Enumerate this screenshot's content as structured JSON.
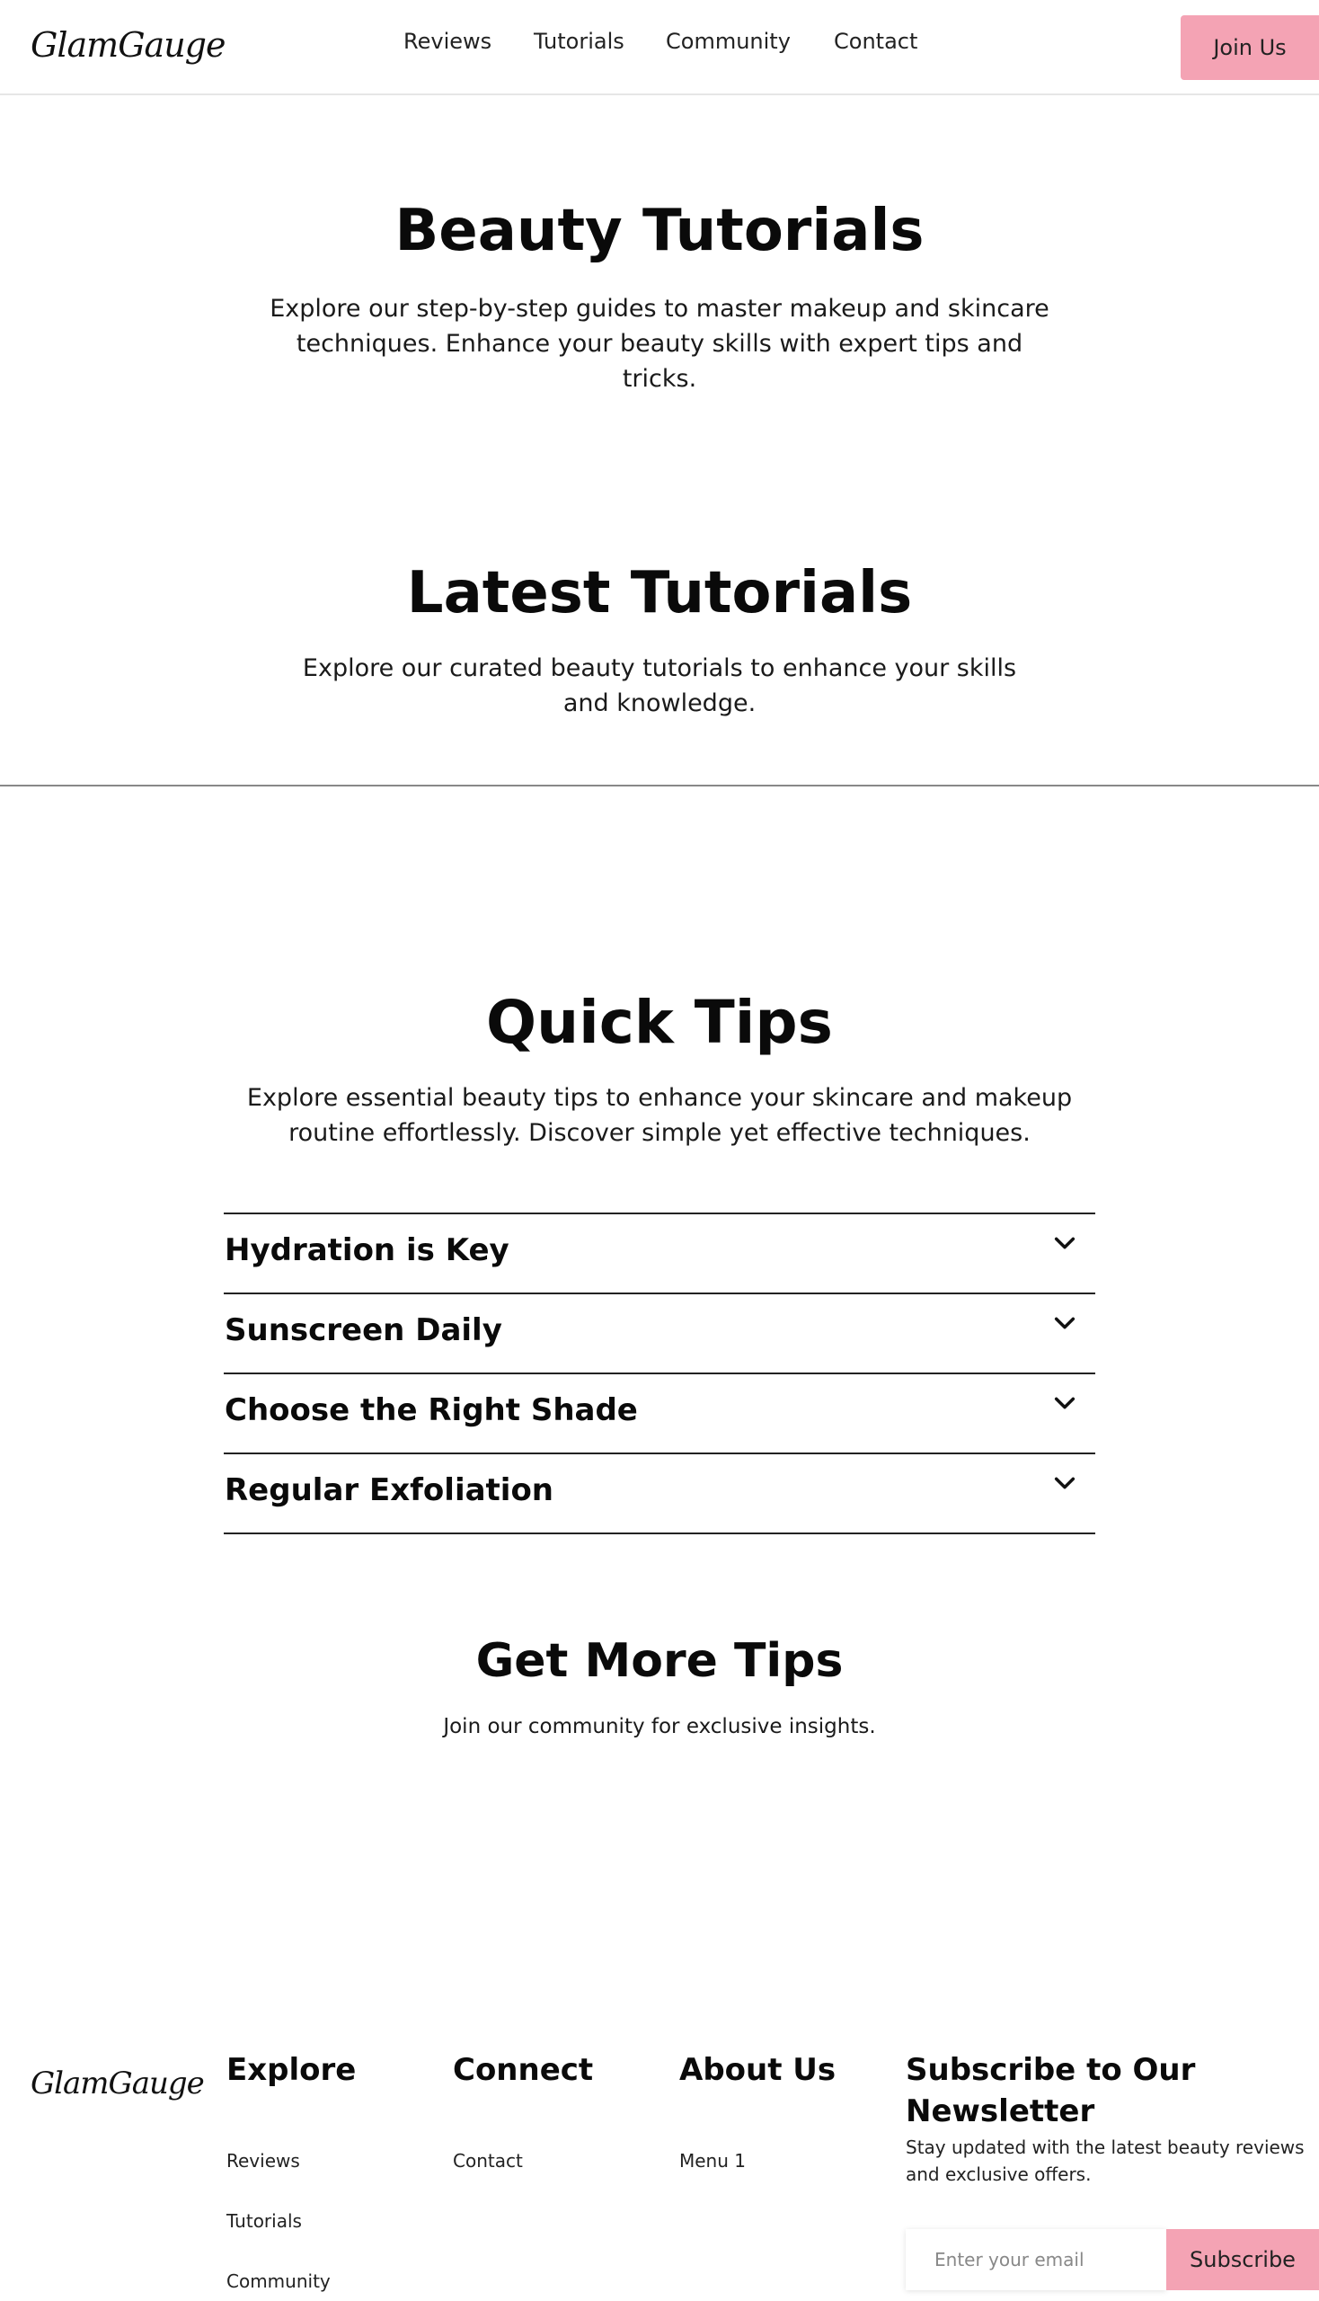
{
  "brand": {
    "logo_text": "GlamGauge"
  },
  "header": {
    "nav": [
      {
        "label": "Reviews"
      },
      {
        "label": "Tutorials"
      },
      {
        "label": "Community"
      },
      {
        "label": "Contact"
      }
    ],
    "cta_label": "Join Us"
  },
  "hero": {
    "title": "Beauty Tutorials",
    "description": "Explore our step-by-step guides to master makeup and skincare techniques. Enhance your beauty skills with expert tips and tricks."
  },
  "latest": {
    "title": "Latest Tutorials",
    "description": "Explore our curated beauty tutorials to enhance your skills and knowledge."
  },
  "quick_tips": {
    "title": "Quick Tips",
    "description": "Explore essential beauty tips to enhance your skincare and makeup routine effortlessly. Discover simple yet effective techniques.",
    "items": [
      {
        "title": "Hydration is Key"
      },
      {
        "title": "Sunscreen Daily"
      },
      {
        "title": "Choose the Right Shade"
      },
      {
        "title": "Regular Exfoliation"
      }
    ]
  },
  "more_tips": {
    "title": "Get More Tips",
    "description": "Join our community for exclusive insights."
  },
  "footer": {
    "explore": {
      "heading": "Explore",
      "links": [
        "Reviews",
        "Tutorials",
        "Community"
      ]
    },
    "connect": {
      "heading": "Connect",
      "links": [
        "Contact"
      ]
    },
    "about": {
      "heading": "About Us",
      "links": [
        "Menu 1"
      ]
    },
    "newsletter": {
      "heading": "Subscribe to Our Newsletter",
      "description": "Stay updated with the latest beauty reviews and exclusive offers.",
      "email_placeholder": "Enter your email",
      "button_label": "Subscribe"
    }
  },
  "colors": {
    "accent": "#f4a3b4",
    "text": "#111111",
    "divider": "#888888"
  }
}
